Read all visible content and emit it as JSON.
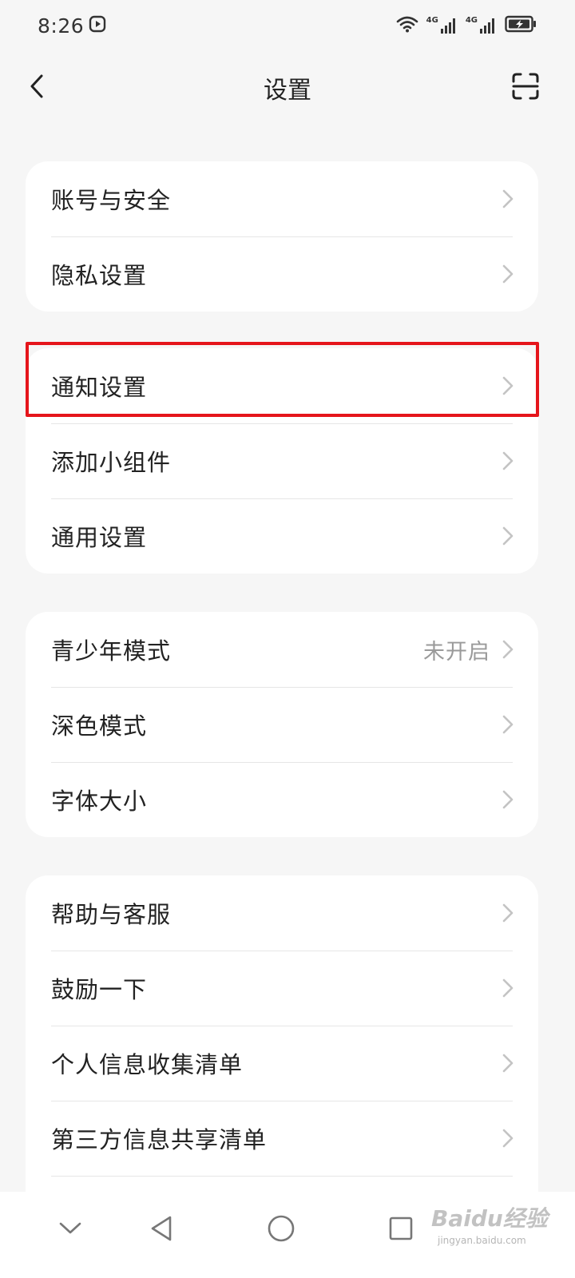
{
  "status_bar": {
    "time": "8:26",
    "net1": "4G",
    "net2": "4G"
  },
  "header": {
    "title": "设置"
  },
  "groups": [
    {
      "items": [
        {
          "label": "账号与安全"
        },
        {
          "label": "隐私设置"
        }
      ]
    },
    {
      "items": [
        {
          "label": "通知设置"
        },
        {
          "label": "添加小组件"
        },
        {
          "label": "通用设置"
        }
      ]
    },
    {
      "items": [
        {
          "label": "青少年模式",
          "value": "未开启"
        },
        {
          "label": "深色模式"
        },
        {
          "label": "字体大小"
        }
      ]
    },
    {
      "items": [
        {
          "label": "帮助与客服"
        },
        {
          "label": "鼓励一下"
        },
        {
          "label": "个人信息收集清单"
        },
        {
          "label": "第三方信息共享清单"
        }
      ]
    }
  ],
  "highlight_color": "#e5151b",
  "watermark": {
    "text": "Baidu经验",
    "sub": "jingyan.baidu.com"
  },
  "icons": {
    "back": "chevron-left-icon",
    "scan": "scan-icon",
    "row_arrow": "chevron-right-icon",
    "nav": [
      "collapse-icon",
      "back-triangle-icon",
      "home-circle-icon",
      "recents-square-icon"
    ]
  }
}
